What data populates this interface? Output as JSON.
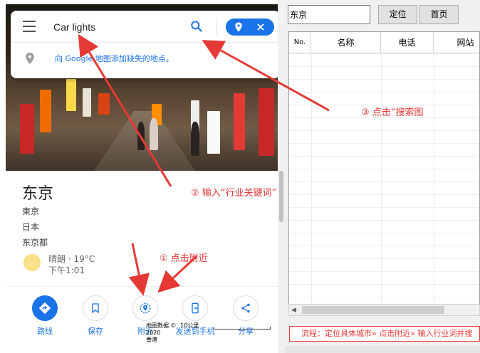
{
  "maps": {
    "search": {
      "value": "Car lights"
    },
    "add_place": "向 Google 地图添加缺失的地点。",
    "place": {
      "title": "东京",
      "lines": [
        "東京",
        "日本",
        "东京都"
      ],
      "weather": {
        "condition": "晴朗 · 19°C",
        "time": "下午1:01"
      }
    },
    "actions": [
      {
        "label": "路线",
        "icon": "directions-icon"
      },
      {
        "label": "保存",
        "icon": "bookmark-icon"
      },
      {
        "label": "附近",
        "icon": "nearby-icon"
      },
      {
        "label": "发送到手机",
        "icon": "send-to-phone-icon"
      },
      {
        "label": "分享",
        "icon": "share-icon"
      }
    ],
    "footer": {
      "data_line": "地图数据 ©",
      "year": "2020",
      "region": "香港",
      "scale": "10公里"
    }
  },
  "annotations": {
    "step1": "① 点击附近",
    "step2": "② 输入“行业关键词”",
    "step3": "③ 点击“搜索图"
  },
  "tool": {
    "city_input": "东京",
    "locate_button": "定位",
    "home_button": "首页",
    "columns": [
      "No.",
      "名称",
      "电话",
      "网站"
    ],
    "flow": "流程：定位具体城市» 点击附近» 输入行业词并搜"
  },
  "colors": {
    "accent": "#1a73e8",
    "annotation": "#e53935"
  }
}
